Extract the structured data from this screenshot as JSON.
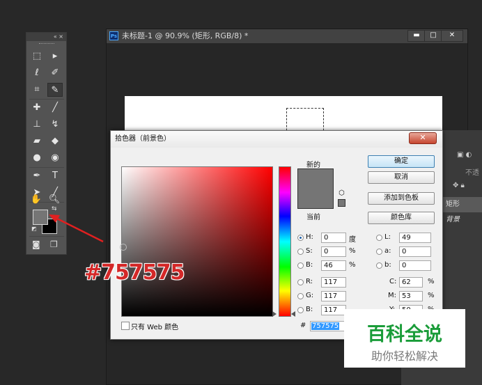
{
  "toolbox": {
    "header_glyphs": "«  ×"
  },
  "document": {
    "title": "未标题-1 @ 90.9% (矩形, RGB/8) *",
    "ps_badge": "Ps",
    "min_glyph": "▬",
    "max_glyph": "□",
    "close_glyph": "✕"
  },
  "layers": {
    "row_shape": "矩形",
    "row_bg": "背景",
    "blend_partial": "不透"
  },
  "picker": {
    "title": "拾色器（前景色）",
    "close_glyph": "✕",
    "new_label": "新的",
    "current_label": "当前",
    "buttons": {
      "ok": "确定",
      "cancel": "取消",
      "add_swatch": "添加到色板",
      "libraries": "颜色库"
    },
    "hsb": [
      {
        "label": "H:",
        "value": "0",
        "unit": "度",
        "checked": true
      },
      {
        "label": "S:",
        "value": "0",
        "unit": "%",
        "checked": false
      },
      {
        "label": "B:",
        "value": "46",
        "unit": "%",
        "checked": false
      }
    ],
    "rgb": [
      {
        "label": "R:",
        "value": "117"
      },
      {
        "label": "G:",
        "value": "117"
      },
      {
        "label": "B:",
        "value": "117"
      }
    ],
    "lab": [
      {
        "label": "L:",
        "value": "49"
      },
      {
        "label": "a:",
        "value": "0"
      },
      {
        "label": "b:",
        "value": "0"
      }
    ],
    "cmyk": [
      {
        "label": "C:",
        "value": "62",
        "unit": "%"
      },
      {
        "label": "M:",
        "value": "53",
        "unit": "%"
      },
      {
        "label": "Y:",
        "value": "50",
        "unit": "%"
      }
    ],
    "web_only_label": "只有 Web 颜色",
    "hex_prefix": "#",
    "hex_value": "757575",
    "color": "#757575"
  },
  "annotation": {
    "hex_text": "#757575",
    "color": "#d42828"
  },
  "watermark": {
    "main": "百科全说",
    "sub": "助你轻松解决"
  }
}
